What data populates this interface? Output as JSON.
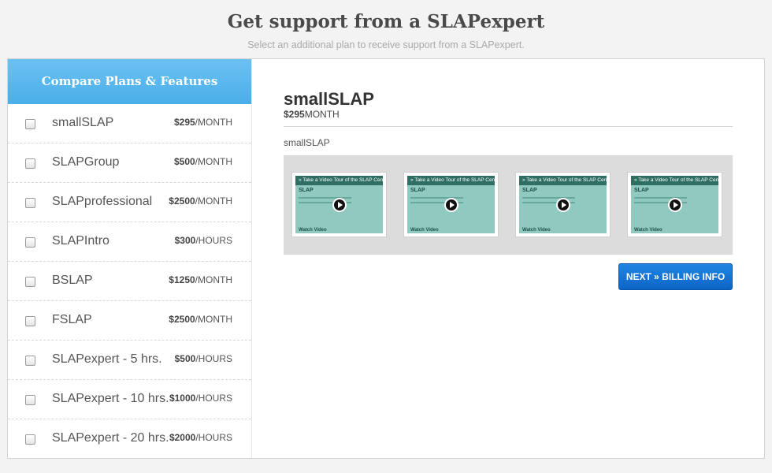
{
  "header": {
    "title": "Get support from a SLAPexpert",
    "subtitle": "Select an additional plan to receive support from a SLAPexpert."
  },
  "sidebar": {
    "title": "Compare Plans & Features",
    "plans": [
      {
        "name": "smallSLAP",
        "price": "$295",
        "unit": "/MONTH"
      },
      {
        "name": "SLAPGroup",
        "price": "$500",
        "unit": "/MONTH"
      },
      {
        "name": "SLAPprofessional",
        "price": "$2500",
        "unit": "/MONTH"
      },
      {
        "name": "SLAPIntro",
        "price": "$300",
        "unit": "/HOURS"
      },
      {
        "name": "BSLAP",
        "price": "$1250",
        "unit": "/MONTH"
      },
      {
        "name": "FSLAP",
        "price": "$2500",
        "unit": "/MONTH"
      },
      {
        "name": "SLAPexpert - 5 hrs.",
        "price": "$500",
        "unit": "/HOURS"
      },
      {
        "name": "SLAPexpert - 10 hrs.",
        "price": "$1000",
        "unit": "/HOURS"
      },
      {
        "name": "SLAPexpert - 20 hrs.",
        "price": "$2000",
        "unit": "/HOURS"
      }
    ]
  },
  "detail": {
    "title": "smallSLAP",
    "price": "$295",
    "unit": "MONTH",
    "description": "smallSLAP",
    "videos": [
      {
        "heading": "» Take a Video Tour of the SLAP Center",
        "logo": "SLAP",
        "caption": "Watch Video"
      },
      {
        "heading": "» Take a Video Tour of the SLAP Center",
        "logo": "SLAP",
        "caption": "Watch Video"
      },
      {
        "heading": "» Take a Video Tour of the SLAP Center",
        "logo": "SLAP",
        "caption": "Watch Video"
      },
      {
        "heading": "» Take a Video Tour of the SLAP Center",
        "logo": "SLAP",
        "caption": "Watch Video"
      }
    ],
    "next_button": "NEXT » BILLING INFO"
  }
}
